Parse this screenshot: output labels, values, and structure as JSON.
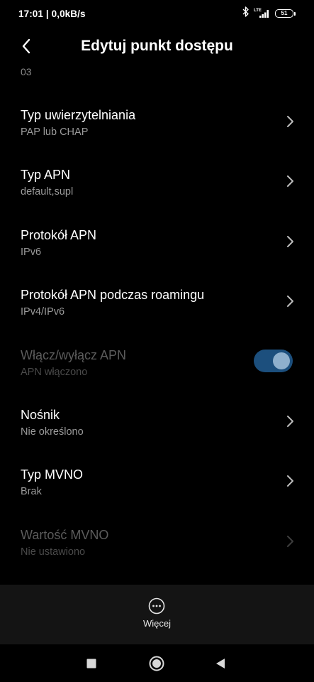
{
  "status_bar": {
    "time_speed": "17:01 | 0,0kB/s",
    "network_label": "LTE",
    "battery": "51"
  },
  "header": {
    "title": "Edytuj punkt dostępu"
  },
  "partial_value": "03",
  "settings": [
    {
      "title": "Typ uwierzytelniania",
      "value": "PAP lub CHAP"
    },
    {
      "title": "Typ APN",
      "value": "default,supl"
    },
    {
      "title": "Protokół APN",
      "value": "IPv6"
    },
    {
      "title": "Protokół APN podczas roamingu",
      "value": "IPv4/IPv6"
    },
    {
      "title": "Włącz/wyłącz APN",
      "value": "APN włączono",
      "toggle_on": true
    },
    {
      "title": "Nośnik",
      "value": "Nie określono"
    },
    {
      "title": "Typ MVNO",
      "value": "Brak"
    },
    {
      "title": "Wartość MVNO",
      "value": "Nie ustawiono"
    }
  ],
  "action_bar": {
    "more_label": "Więcej"
  },
  "icons": {
    "back": "back-arrow-icon",
    "chevron": "chevron-right-icon",
    "more": "more-dots-icon",
    "recents": "square-recents-icon",
    "home": "circle-home-icon",
    "back_nav": "triangle-back-icon"
  },
  "colors": {
    "background": "#000000",
    "toggle_track": "#1c4f7d",
    "toggle_knob": "#8fb0cd",
    "action_bar": "#141414"
  }
}
